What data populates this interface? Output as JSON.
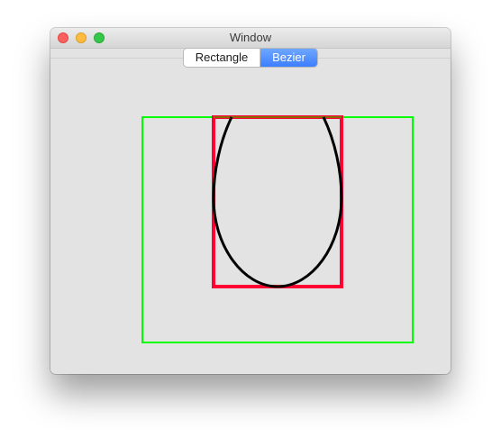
{
  "window": {
    "title": "Window"
  },
  "segmented_control": {
    "options": [
      "Rectangle",
      "Bezier"
    ],
    "selected": "Bezier"
  },
  "colors": {
    "outer_rect": "#00ff00",
    "inner_rect": "#ff0033",
    "curve": "#000000",
    "top_edge": "#8a6a00",
    "selected_segment": "#4d8dff"
  },
  "icons": [
    "close-button",
    "minimize-button",
    "zoom-button"
  ]
}
